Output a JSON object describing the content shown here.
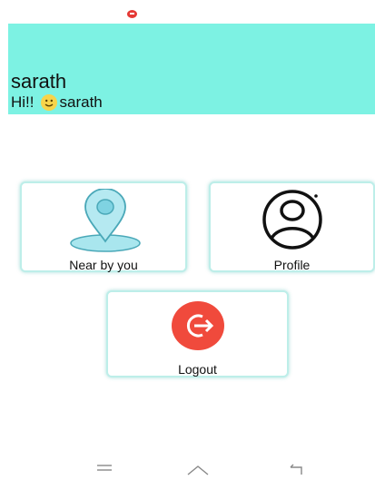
{
  "status_bar": {
    "indicator_icon": "red-notification-icon"
  },
  "header": {
    "user_name": "sarath",
    "greeting_prefix": "Hi!!",
    "greeting_emoji": "smiley-icon",
    "greeting_name": "sarath",
    "background_color": "#7df2e3"
  },
  "menu": {
    "near_by_you_label": "Near by you",
    "profile_label": "Profile",
    "logout_label": "Logout",
    "logout_color": "#f04a3c"
  },
  "nav_bar": {
    "items": [
      "menu-icon",
      "home-icon",
      "back-icon"
    ]
  }
}
